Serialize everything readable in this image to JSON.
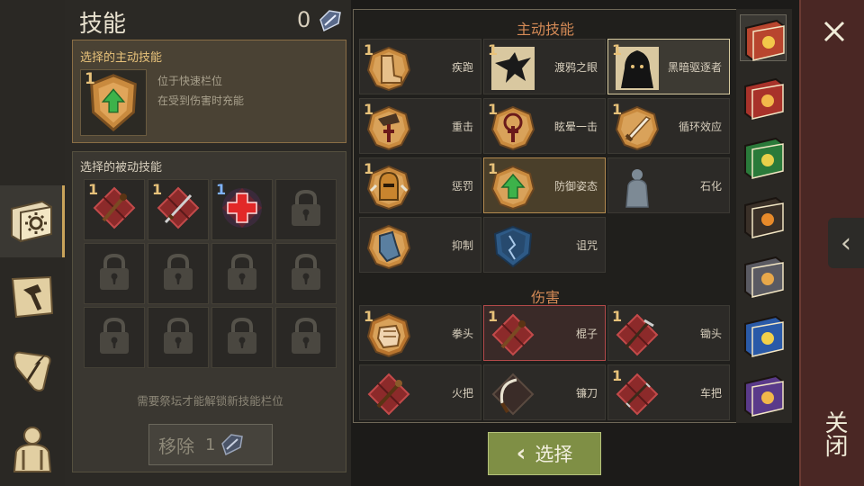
{
  "header": {
    "title": "技能",
    "gem_count": "0"
  },
  "active_section": {
    "label": "选择的主动技能",
    "level": "1",
    "desc_line1": "位于快速栏位",
    "desc_line2": "在受到伤害时充能"
  },
  "passive_section": {
    "label": "选择的被动技能",
    "slots": [
      {
        "level": "1",
        "state": "filled",
        "icon": "club-icon"
      },
      {
        "level": "1",
        "state": "filled",
        "icon": "sword-icon"
      },
      {
        "level": "1",
        "state": "filled",
        "icon": "medkit-cross-icon"
      },
      {
        "level": "",
        "state": "locked",
        "icon": "lock-icon"
      },
      {
        "level": "",
        "state": "locked",
        "icon": "lock-icon"
      },
      {
        "level": "",
        "state": "locked",
        "icon": "lock-icon"
      },
      {
        "level": "",
        "state": "locked",
        "icon": "lock-icon"
      },
      {
        "level": "",
        "state": "locked",
        "icon": "lock-icon"
      },
      {
        "level": "",
        "state": "locked",
        "icon": "lock-icon"
      },
      {
        "level": "",
        "state": "locked",
        "icon": "lock-icon"
      },
      {
        "level": "",
        "state": "locked",
        "icon": "lock-icon"
      },
      {
        "level": "",
        "state": "locked",
        "icon": "lock-icon"
      }
    ],
    "unlock_hint": "需要祭坛才能解锁新技能栏位",
    "remove_label": "移除",
    "remove_cost": "1"
  },
  "skills": {
    "active_title": "主动技能",
    "damage_title": "伤害",
    "active": [
      {
        "name": "疾跑",
        "level": "1",
        "icon": "boots-icon"
      },
      {
        "name": "渡鸦之眼",
        "level": "1",
        "icon": "raven-icon"
      },
      {
        "name": "黑暗驱逐者",
        "level": "1",
        "icon": "hooded-figure-icon"
      },
      {
        "name": "重击",
        "level": "1",
        "icon": "hammer-icon"
      },
      {
        "name": "眩晕一击",
        "level": "1",
        "icon": "stun-icon"
      },
      {
        "name": "循环效应",
        "level": "1",
        "icon": "blade-icon"
      },
      {
        "name": "惩罚",
        "level": "1",
        "icon": "helmet-icon"
      },
      {
        "name": "防御姿态",
        "level": "1",
        "icon": "shield-up-icon"
      },
      {
        "name": "石化",
        "level": "",
        "icon": "stone-figure-icon"
      },
      {
        "name": "抑制",
        "level": "",
        "icon": "gauntlet-icon"
      },
      {
        "name": "诅咒",
        "level": "",
        "icon": "cracked-shield-icon"
      }
    ],
    "damage": [
      {
        "name": "拳头",
        "level": "1",
        "icon": "fist-icon"
      },
      {
        "name": "棍子",
        "level": "1",
        "icon": "club-icon"
      },
      {
        "name": "锄头",
        "level": "1",
        "icon": "hoe-icon"
      },
      {
        "name": "火把",
        "level": "",
        "icon": "torch-icon"
      },
      {
        "name": "镰刀",
        "level": "",
        "icon": "sickle-icon"
      },
      {
        "name": "车把",
        "level": "1",
        "icon": "handlebar-icon"
      }
    ]
  },
  "select_button": {
    "label": "选择"
  },
  "close": {
    "label": "关闭"
  },
  "colors": {
    "accent": "#c9a35a",
    "section_title": "#d48a56",
    "select": "#7f8f45",
    "rightbar": "#4a2724"
  }
}
